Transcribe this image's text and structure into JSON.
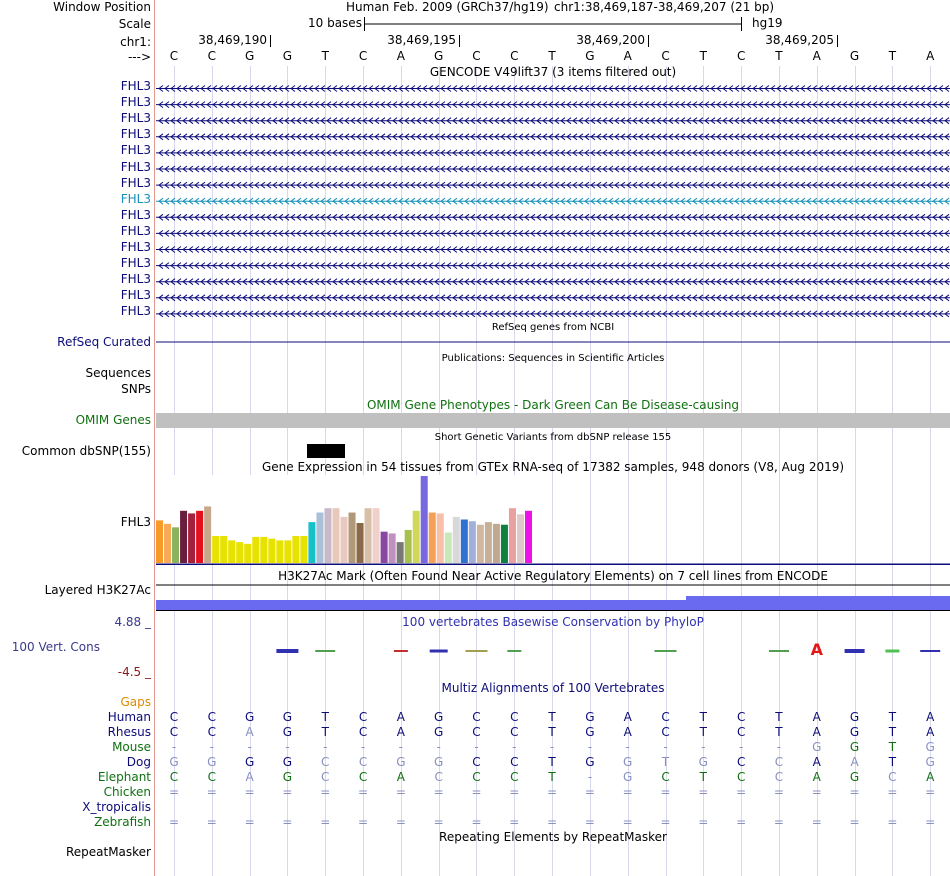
{
  "header": {
    "window_position_label": "Window Position",
    "scale_label": "Scale",
    "chr_label": "chr1:",
    "strand_label": "--->",
    "assembly_text": "Human Feb. 2009 (GRCh37/hg19)",
    "coords_text": "chr1:38,469,187-38,469,207 (21 bp)",
    "scale_text": "10 bases",
    "hg_text": "hg19",
    "ruler_ticks": [
      "38,469,190",
      "38,469,195",
      "38,469,200",
      "38,469,205"
    ]
  },
  "sequence": [
    "C",
    "C",
    "G",
    "G",
    "T",
    "C",
    "A",
    "G",
    "C",
    "C",
    "T",
    "G",
    "A",
    "C",
    "T",
    "C",
    "T",
    "A",
    "G",
    "T",
    "A"
  ],
  "gencode": {
    "title": "GENCODE V49lift37 (3 items filtered out)",
    "rows": [
      {
        "label": "FHL3",
        "highlight": false
      },
      {
        "label": "FHL3",
        "highlight": false
      },
      {
        "label": "FHL3",
        "highlight": false
      },
      {
        "label": "FHL3",
        "highlight": false
      },
      {
        "label": "FHL3",
        "highlight": false
      },
      {
        "label": "FHL3",
        "highlight": false
      },
      {
        "label": "FHL3",
        "highlight": false
      },
      {
        "label": "FHL3",
        "highlight": true
      },
      {
        "label": "FHL3",
        "highlight": false
      },
      {
        "label": "FHL3",
        "highlight": false
      },
      {
        "label": "FHL3",
        "highlight": false
      },
      {
        "label": "FHL3",
        "highlight": false
      },
      {
        "label": "FHL3",
        "highlight": false
      },
      {
        "label": "FHL3",
        "highlight": false
      },
      {
        "label": "FHL3",
        "highlight": false
      }
    ]
  },
  "refseq": {
    "title": "RefSeq genes from NCBI",
    "label": "RefSeq Curated"
  },
  "publications": {
    "title": "Publications: Sequences in Scientific Articles",
    "label_sequences": "Sequences",
    "label_snps": "SNPs"
  },
  "omim": {
    "title": "OMIM Gene Phenotypes - Dark Green Can Be Disease-causing",
    "label": "OMIM Genes"
  },
  "dbsnp": {
    "title": "Short Genetic Variants from dbSNP release 155",
    "label": "Common dbSNP(155)"
  },
  "gtex": {
    "title": "Gene Expression in 54 tissues from GTEx RNA-seq of 17382 samples, 948 donors (V8, Aug 2019)",
    "label": "FHL3",
    "bars": [
      {
        "color": "#f79a28",
        "value": 0.49
      },
      {
        "color": "#f8aa58",
        "value": 0.45
      },
      {
        "color": "#8ab45c",
        "value": 0.41
      },
      {
        "color": "#6a1e3e",
        "value": 0.6
      },
      {
        "color": "#a4203c",
        "value": 0.57
      },
      {
        "color": "#e5101e",
        "value": 0.6
      },
      {
        "color": "#c8a88a",
        "value": 0.65
      },
      {
        "color": "#e8e200",
        "value": 0.31
      },
      {
        "color": "#e8e200",
        "value": 0.31
      },
      {
        "color": "#e8e200",
        "value": 0.26
      },
      {
        "color": "#e8e200",
        "value": 0.24
      },
      {
        "color": "#e8e200",
        "value": 0.22
      },
      {
        "color": "#e8e200",
        "value": 0.3
      },
      {
        "color": "#e8e200",
        "value": 0.3
      },
      {
        "color": "#e8e200",
        "value": 0.28
      },
      {
        "color": "#e8e200",
        "value": 0.26
      },
      {
        "color": "#e8e200",
        "value": 0.26
      },
      {
        "color": "#e8e200",
        "value": 0.31
      },
      {
        "color": "#e8e200",
        "value": 0.31
      },
      {
        "color": "#18c0c8",
        "value": 0.47
      },
      {
        "color": "#a8c0d8",
        "value": 0.58
      },
      {
        "color": "#c8b8c8",
        "value": 0.63
      },
      {
        "color": "#e8c8b8",
        "value": 0.63
      },
      {
        "color": "#e8c8c0",
        "value": 0.53
      },
      {
        "color": "#b09878",
        "value": 0.58
      },
      {
        "color": "#8a6848",
        "value": 0.46
      },
      {
        "color": "#d8c0a8",
        "value": 0.63
      },
      {
        "color": "#f0d0c8",
        "value": 0.63
      },
      {
        "color": "#8848a0",
        "value": 0.36
      },
      {
        "color": "#c090c0",
        "value": 0.34
      },
      {
        "color": "#787878",
        "value": 0.24
      },
      {
        "color": "#a8c050",
        "value": 0.38
      },
      {
        "color": "#d0d858",
        "value": 0.6
      },
      {
        "color": "#7868e0",
        "value": 1.0
      },
      {
        "color": "#f5a058",
        "value": 0.58
      },
      {
        "color": "#f8c0a8",
        "value": 0.57
      },
      {
        "color": "#c8e8b8",
        "value": 0.35
      },
      {
        "color": "#d8d8d8",
        "value": 0.53
      },
      {
        "color": "#3070d0",
        "value": 0.5
      },
      {
        "color": "#a0b0d8",
        "value": 0.48
      },
      {
        "color": "#d0b8a0",
        "value": 0.44
      },
      {
        "color": "#c8b098",
        "value": 0.47
      },
      {
        "color": "#c0a890",
        "value": 0.45
      },
      {
        "color": "#108040",
        "value": 0.44
      },
      {
        "color": "#e8a0a0",
        "value": 0.63
      },
      {
        "color": "#e0c8c8",
        "value": 0.56
      },
      {
        "color": "#f010e8",
        "value": 0.6
      }
    ]
  },
  "h3k27ac": {
    "title": "H3K27Ac Mark (Often Found Near Active Regulatory Elements) on 7 cell lines from ENCODE",
    "label": "Layered H3K27Ac"
  },
  "conservation": {
    "title": "100 vertebrates Basewise Conservation by PhyloP",
    "label": "100 Vert. Cons",
    "max_label": "4.88 _",
    "min_label": "-4.5 _",
    "logo_letter": "A"
  },
  "multiz": {
    "title": "Multiz Alignments of 100 Vertebrates",
    "gaps_label": "Gaps",
    "species": [
      {
        "name": "Human",
        "color": "#0c0c78",
        "seq": [
          "C",
          "C",
          "G",
          "G",
          "T",
          "C",
          "A",
          "G",
          "C",
          "C",
          "T",
          "G",
          "A",
          "C",
          "T",
          "C",
          "T",
          "A",
          "G",
          "T",
          "A"
        ],
        "faded": []
      },
      {
        "name": "Rhesus",
        "color": "#0c0c78",
        "seq": [
          "C",
          "C",
          "A",
          "G",
          "T",
          "C",
          "A",
          "G",
          "C",
          "C",
          "T",
          "G",
          "A",
          "C",
          "T",
          "C",
          "T",
          "A",
          "G",
          "T",
          "A"
        ],
        "faded": [
          2
        ]
      },
      {
        "name": "Mouse",
        "color": "#107010",
        "seq": [
          "-",
          "-",
          "-",
          "-",
          "-",
          "-",
          "-",
          "-",
          "-",
          "-",
          "-",
          "-",
          "-",
          "-",
          "-",
          "-",
          "-",
          "G",
          "G",
          "T",
          "G"
        ],
        "faded": [
          0,
          1,
          2,
          3,
          4,
          5,
          6,
          7,
          8,
          9,
          10,
          11,
          12,
          13,
          14,
          15,
          16,
          17,
          20
        ]
      },
      {
        "name": "Dog",
        "color": "#0c0c78",
        "seq": [
          "G",
          "G",
          "G",
          "G",
          "C",
          "C",
          "G",
          "G",
          "C",
          "C",
          "T",
          "G",
          "G",
          "T",
          "G",
          "C",
          "C",
          "A",
          "A",
          "T",
          "G"
        ],
        "faded": [
          0,
          1,
          4,
          5,
          6,
          7,
          12,
          13,
          14,
          16,
          18,
          20
        ]
      },
      {
        "name": "Elephant",
        "color": "#107010",
        "seq": [
          "C",
          "C",
          "A",
          "G",
          "C",
          "C",
          "A",
          "C",
          "C",
          "C",
          "T",
          "-",
          "G",
          "C",
          "T",
          "C",
          "C",
          "A",
          "G",
          "C",
          "A"
        ],
        "faded": [
          2,
          4,
          7,
          11,
          12,
          16,
          19
        ]
      },
      {
        "name": "Chicken",
        "color": "#107010",
        "seq": [
          "=",
          "=",
          "=",
          "=",
          "=",
          "=",
          "=",
          "=",
          "=",
          "=",
          "=",
          "=",
          "=",
          "=",
          "=",
          "=",
          "=",
          "=",
          "=",
          "=",
          "="
        ],
        "faded": [
          0,
          1,
          2,
          3,
          4,
          5,
          6,
          7,
          8,
          9,
          10,
          11,
          12,
          13,
          14,
          15,
          16,
          17,
          18,
          19,
          20
        ]
      },
      {
        "name": "X_tropicalis",
        "color": "#0c0c78",
        "seq": [],
        "faded": []
      },
      {
        "name": "Zebrafish",
        "color": "#107010",
        "seq": [
          "=",
          "=",
          "=",
          "=",
          "=",
          "=",
          "=",
          "=",
          "=",
          "=",
          "=",
          "=",
          "=",
          "=",
          "=",
          "=",
          "=",
          "=",
          "=",
          "=",
          "="
        ],
        "faded": [
          0,
          1,
          2,
          3,
          4,
          5,
          6,
          7,
          8,
          9,
          10,
          11,
          12,
          13,
          14,
          15,
          16,
          17,
          18,
          19,
          20
        ]
      }
    ]
  },
  "repeatmasker": {
    "title": "Repeating Elements by RepeatMasker",
    "label": "RepeatMasker"
  },
  "colors": {
    "gene_navy": "#0c0c78",
    "gene_teal": "#1890b8",
    "omim_green": "#107010",
    "omim_gray": "#c0c0c0",
    "h3k27ac_blue": "#6a6af0",
    "cons_blue": "#3030b0",
    "gaps_orange": "#e08a00",
    "max_green": "#3a3a8a",
    "min_red": "#8b1a1a"
  }
}
